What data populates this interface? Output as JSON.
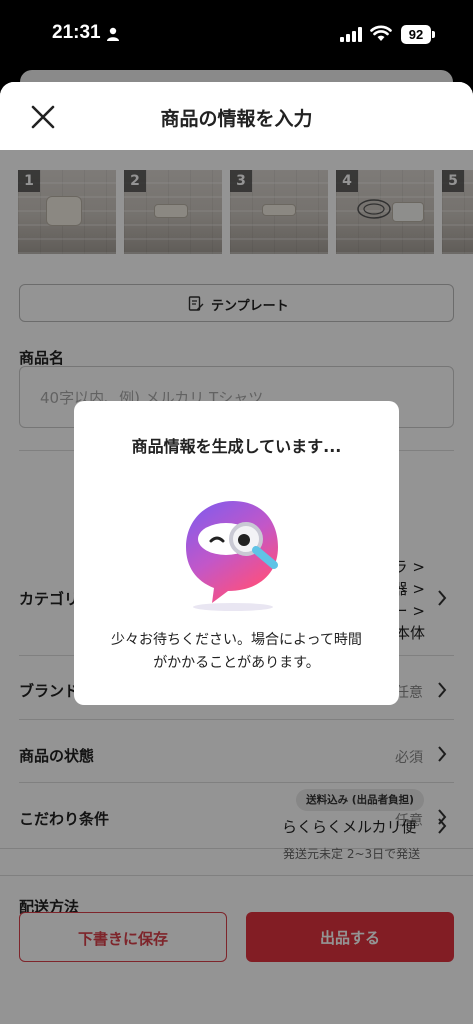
{
  "status_bar": {
    "time": "21:31",
    "battery": "92"
  },
  "header": {
    "title": "商品の情報を入力"
  },
  "photos": [
    "1",
    "2",
    "3",
    "4",
    "5"
  ],
  "template_button": {
    "label": "テンプレート"
  },
  "product_name": {
    "label": "商品名",
    "placeholder": "40字以内、例) メルカリ Tシャツ"
  },
  "category": {
    "label": "カテゴリー",
    "lines": [
      "ラ >",
      "器 >",
      "ー >",
      "本体"
    ]
  },
  "brand": {
    "label": "ブランド",
    "value": "任意"
  },
  "condition": {
    "label": "商品の状態",
    "value": "必須"
  },
  "preferences": {
    "label": "こだわり条件",
    "value": "任意"
  },
  "shipping": {
    "label": "配送方法",
    "badge": "送料込み (出品者負担)",
    "value": "らくらくメルカリ便",
    "note": "発送元未定 2~3日で発送"
  },
  "actions": {
    "draft": "下書きに保存",
    "list": "出品する"
  },
  "modal": {
    "title": "商品情報を生成しています...",
    "message_line1": "少々お待ちください。場合によって時間",
    "message_line2": "がかかることがあります。"
  }
}
